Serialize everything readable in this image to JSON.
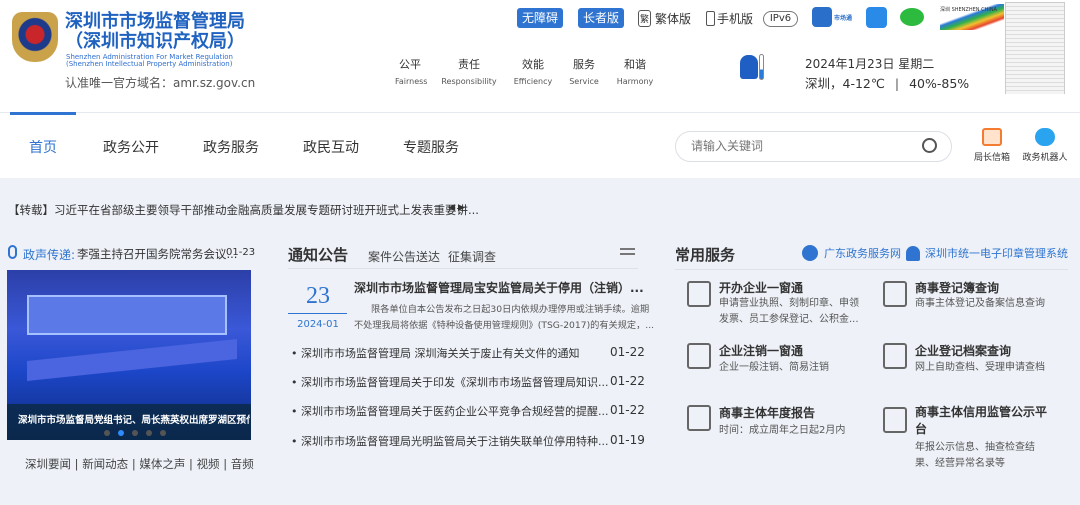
{
  "header": {
    "title_line1": "深圳市市场监督管理局",
    "title_line2": "（深圳市知识产权局）",
    "en_line1": "Shenzhen Administration For Market Regulation",
    "en_line2": "(Shenzhen Intellectual Property Administration)",
    "domain": "认准唯一官方域名：amr.sz.gov.cn",
    "accessibility": "无障碍",
    "elder": "长者版",
    "traditional": "繁体版",
    "traditional_glyph": "繁",
    "mobile": "手机版",
    "ipv6": "IPv6",
    "shitong": "市场通",
    "values": [
      {
        "cn": "公平",
        "en": "Fairness"
      },
      {
        "cn": "责任",
        "en": "Responsibility"
      },
      {
        "cn": "效能",
        "en": "Efficiency"
      },
      {
        "cn": "服务",
        "en": "Service"
      },
      {
        "cn": "和谐",
        "en": "Harmony"
      }
    ],
    "date": "2024年1月23日 星期二",
    "weather": "深圳，4-12℃",
    "humidity": "40%-85%",
    "brand_logo_text": "深圳 SHENZHEN CHINA"
  },
  "nav": {
    "items": [
      "首页",
      "政务公开",
      "政务服务",
      "政民互动",
      "专题服务"
    ],
    "search_placeholder": "请输入关键词",
    "mailbox": "局长信箱",
    "robot": "政务机器人"
  },
  "ticker": {
    "text": "【转载】习近平在省部级主要领导干部推动金融高质量发展专题研讨班开班式上发表重要讲..."
  },
  "voice": {
    "label": "政声传递:",
    "text": "李强主持召开国务院常务会议...",
    "date": "01-23"
  },
  "carousel": {
    "caption": "深圳市市场监督局党组书记、局长燕英权出席罗湖区预付...",
    "active_index": 1,
    "count": 5,
    "links": [
      "深圳要闻",
      "新闻动态",
      "媒体之声",
      "视频",
      "音频"
    ]
  },
  "notice": {
    "title": "通知公告",
    "tabs": [
      "案件公告送达",
      "征集调查"
    ],
    "featured": {
      "day": "23",
      "month": "2024-01",
      "headline": "深圳市市场监督管理局宝安监管局关于停用（注销）...",
      "summary1": "限各单位自本公告发布之日起30日内依规办理停用或注销手续。逾期",
      "summary2": "不处理我局将依据《特种设备使用管理规则》(TSG-2017)的有关规定，..."
    },
    "items": [
      {
        "text": "深圳市市场监督管理局 深圳海关关于废止有关文件的通知",
        "date": "01-22"
      },
      {
        "text": "深圳市市场监督管理局关于印发《深圳市市场监督管理局知识...",
        "date": "01-22"
      },
      {
        "text": "深圳市市场监督管理局关于医药企业公平竞争合规经营的提醒...",
        "date": "01-22"
      },
      {
        "text": "深圳市市场监督管理局光明监管局关于注销失联单位停用特种...",
        "date": "01-19"
      }
    ]
  },
  "services": {
    "title": "常用服务",
    "link1": "广东政务服务网",
    "link2": "深圳市统一电子印章管理系统",
    "items": [
      {
        "title": "开办企业一窗通",
        "desc": "申请营业执照、刻制印章、申领发票、员工参保登记、公积金..."
      },
      {
        "title": "商事登记簿查询",
        "desc": "商事主体登记及备案信息查询"
      },
      {
        "title": "企业注销一窗通",
        "desc": "企业一般注销、简易注销"
      },
      {
        "title": "企业登记档案查询",
        "desc": "网上自助查档、受理申请查档"
      },
      {
        "title": "商事主体年度报告",
        "desc": "时间：成立周年之日起2月内"
      },
      {
        "title": "商事主体信用监管公示平台",
        "desc": "年报公示信息、抽查检查结果、经营异常名录等"
      }
    ]
  },
  "colors": {
    "brand": "#1f62c0",
    "button": "#2f74d0",
    "orange": "#f47c30"
  }
}
